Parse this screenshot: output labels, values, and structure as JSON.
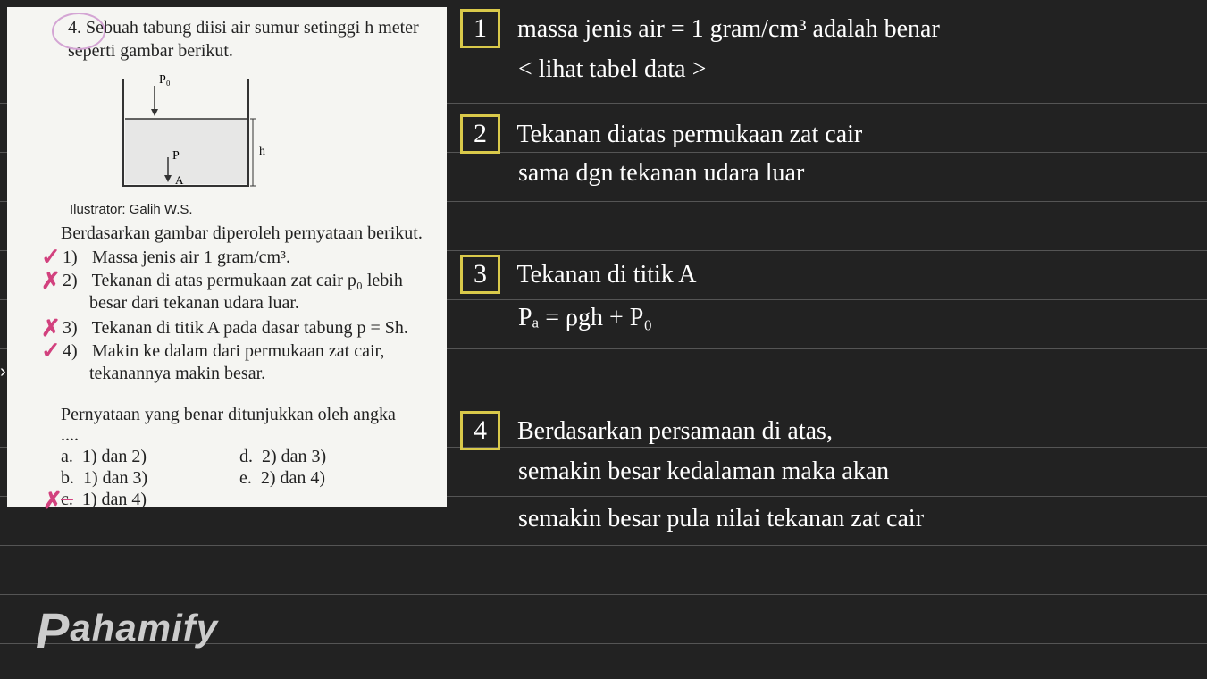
{
  "question": {
    "number": "4.",
    "text_line1": "Sebuah tabung diisi air sumur setinggi h meter",
    "text_line2": "seperti gambar berikut.",
    "diagram": {
      "p0_label": "P₀",
      "h_label": "h",
      "p_label": "P",
      "a_label": "A"
    },
    "illustrator": "Ilustrator: Galih W.S.",
    "statements_intro": "Berdasarkan gambar diperoleh pernyataan berikut.",
    "statements": [
      {
        "num": "1)",
        "text": "Massa jenis air 1 gram/cm³.",
        "mark": "✓"
      },
      {
        "num": "2)",
        "text": "Tekanan di atas permukaan zat cair p₀ lebih besar dari tekanan udara luar.",
        "mark": "✗"
      },
      {
        "num": "3)",
        "text": "Tekanan di titik A pada dasar tabung p = Sh.",
        "mark": "✗"
      },
      {
        "num": "4)",
        "text": "Makin ke dalam dari permukaan zat cair, tekanannya makin besar.",
        "mark": "✓"
      }
    ],
    "prompt": "Pernyataan yang benar ditunjukkan oleh angka",
    "dots": "....",
    "options": {
      "a": {
        "label": "a.",
        "text": "1) dan 2)"
      },
      "b": {
        "label": "b.",
        "text": "1) dan 3)"
      },
      "c": {
        "label": "c.",
        "text": "1) dan 4)",
        "mark": "✗"
      },
      "d": {
        "label": "d.",
        "text": "2) dan 3)"
      },
      "e": {
        "label": "e.",
        "text": "2) dan 4)"
      }
    }
  },
  "annotations": {
    "note1": {
      "num": "1",
      "line1": "massa jenis air = 1 gram/cm³ adalah benar",
      "line2": "< lihat tabel data >"
    },
    "note2": {
      "num": "2",
      "line1": "Tekanan diatas permukaan zat cair",
      "line2": "sama dgn tekanan udara luar"
    },
    "note3": {
      "num": "3",
      "line1": "Tekanan di titik A",
      "line2": "Pₐ = ρgh + P₀"
    },
    "note4": {
      "num": "4",
      "line1": "Berdasarkan persamaan di atas,",
      "line2": "semakin besar kedalaman maka akan",
      "line3": "semakin besar pula nilai tekanan zat cair"
    }
  },
  "watermark": "Pahamify"
}
